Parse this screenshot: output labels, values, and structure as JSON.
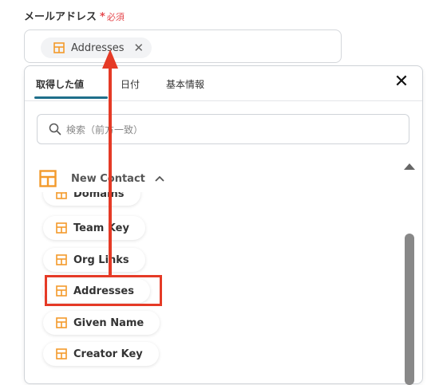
{
  "field": {
    "label": "メールアドレス",
    "required_mark": "*",
    "required_text": "必須",
    "chip_label": "Addresses",
    "chip_close": "✕"
  },
  "panel": {
    "tabs": [
      "取得した値",
      "日付",
      "基本情報"
    ],
    "close": "✕",
    "search_placeholder": "検索（前方一致）",
    "group": {
      "label": "New Contact",
      "chevron": "⌃"
    },
    "items": [
      "Domains",
      "Team Key",
      "Org Links",
      "Addresses",
      "Given Name",
      "Creator Key"
    ]
  },
  "icons": {
    "chip": "table-icon",
    "item": "table-icon",
    "search": "search-icon",
    "close": "close-icon"
  },
  "colors": {
    "accent": "#f39a2b",
    "tab_underline": "#1f6f8b",
    "annotation": "#e53a26"
  }
}
